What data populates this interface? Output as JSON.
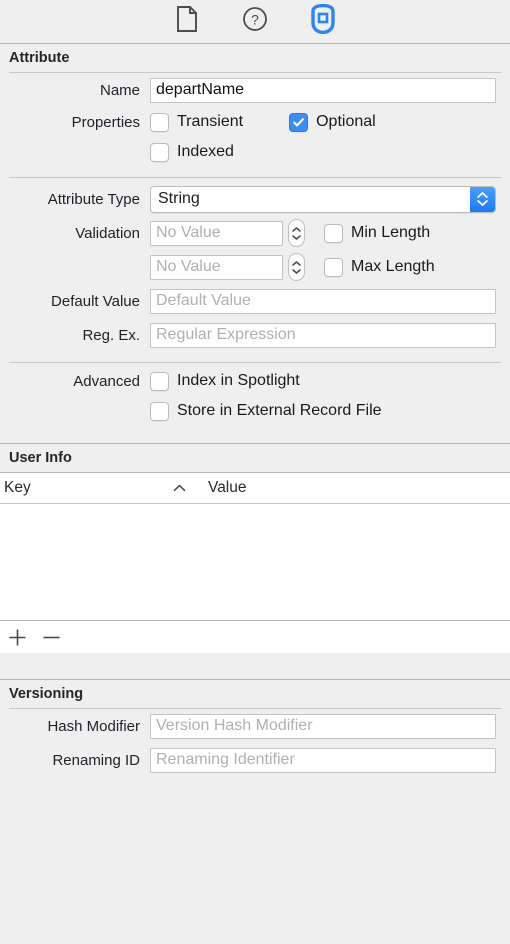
{
  "toolbar": {
    "items": [
      {
        "name": "file-inspector",
        "icon": "document-icon",
        "selected": false
      },
      {
        "name": "quick-help-inspector",
        "icon": "question-circle-icon",
        "selected": false
      },
      {
        "name": "data-model-inspector",
        "icon": "data-model-icon",
        "selected": true
      }
    ],
    "accent_color": "#2c86f0"
  },
  "attribute_section": {
    "title": "Attribute",
    "name_label": "Name",
    "name_value": "departName",
    "properties_label": "Properties",
    "checkboxes": [
      {
        "label": "Transient",
        "checked": false
      },
      {
        "label": "Optional",
        "checked": true
      },
      {
        "label": "Indexed",
        "checked": false
      }
    ],
    "attribute_type_label": "Attribute Type",
    "attribute_type_value": "String",
    "validation_label": "Validation",
    "validation_rows": [
      {
        "placeholder": "No Value",
        "value": "",
        "checkbox_label": "Min Length",
        "checked": false
      },
      {
        "placeholder": "No Value",
        "value": "",
        "checkbox_label": "Max Length",
        "checked": false
      }
    ],
    "default_value_label": "Default Value",
    "default_value_placeholder": "Default Value",
    "default_value": "",
    "regex_label": "Reg. Ex.",
    "regex_placeholder": "Regular Expression",
    "regex_value": "",
    "advanced_label": "Advanced",
    "advanced_checkboxes": [
      {
        "label": "Index in Spotlight",
        "checked": false
      },
      {
        "label": "Store in External Record File",
        "checked": false
      }
    ]
  },
  "user_info_section": {
    "title": "User Info",
    "columns": [
      "Key",
      "Value"
    ],
    "sort_indicator": "chevron-up-icon",
    "rows": [],
    "add_button": "+",
    "remove_button": "−"
  },
  "versioning_section": {
    "title": "Versioning",
    "hash_modifier_label": "Hash Modifier",
    "hash_modifier_placeholder": "Version Hash Modifier",
    "hash_modifier_value": "",
    "renaming_id_label": "Renaming ID",
    "renaming_id_placeholder": "Renaming Identifier",
    "renaming_id_value": ""
  }
}
